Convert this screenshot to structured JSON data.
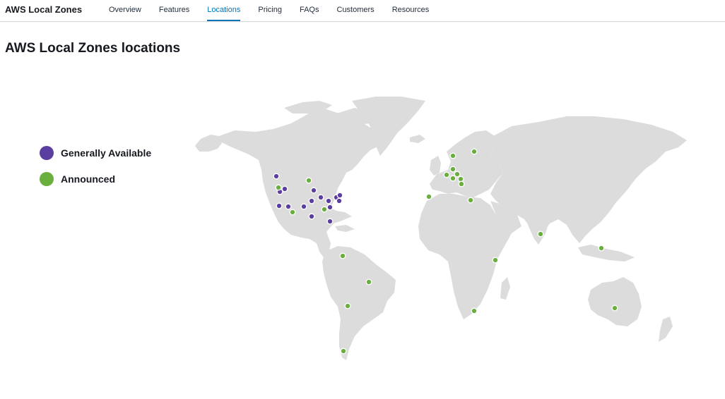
{
  "nav": {
    "brand": "AWS Local Zones",
    "links": [
      {
        "label": "Overview"
      },
      {
        "label": "Features"
      },
      {
        "label": "Locations"
      },
      {
        "label": "Pricing"
      },
      {
        "label": "FAQs"
      },
      {
        "label": "Customers"
      },
      {
        "label": "Resources"
      }
    ],
    "active": "Locations"
  },
  "page": {
    "title": "AWS Local Zones locations"
  },
  "legend": {
    "available_label": "Generally Available",
    "announced_label": "Announced"
  },
  "colors": {
    "available": "#5a3fa0",
    "announced": "#6aaf3d",
    "land": "#dcdcdc",
    "active_link": "#0073bb"
  }
}
